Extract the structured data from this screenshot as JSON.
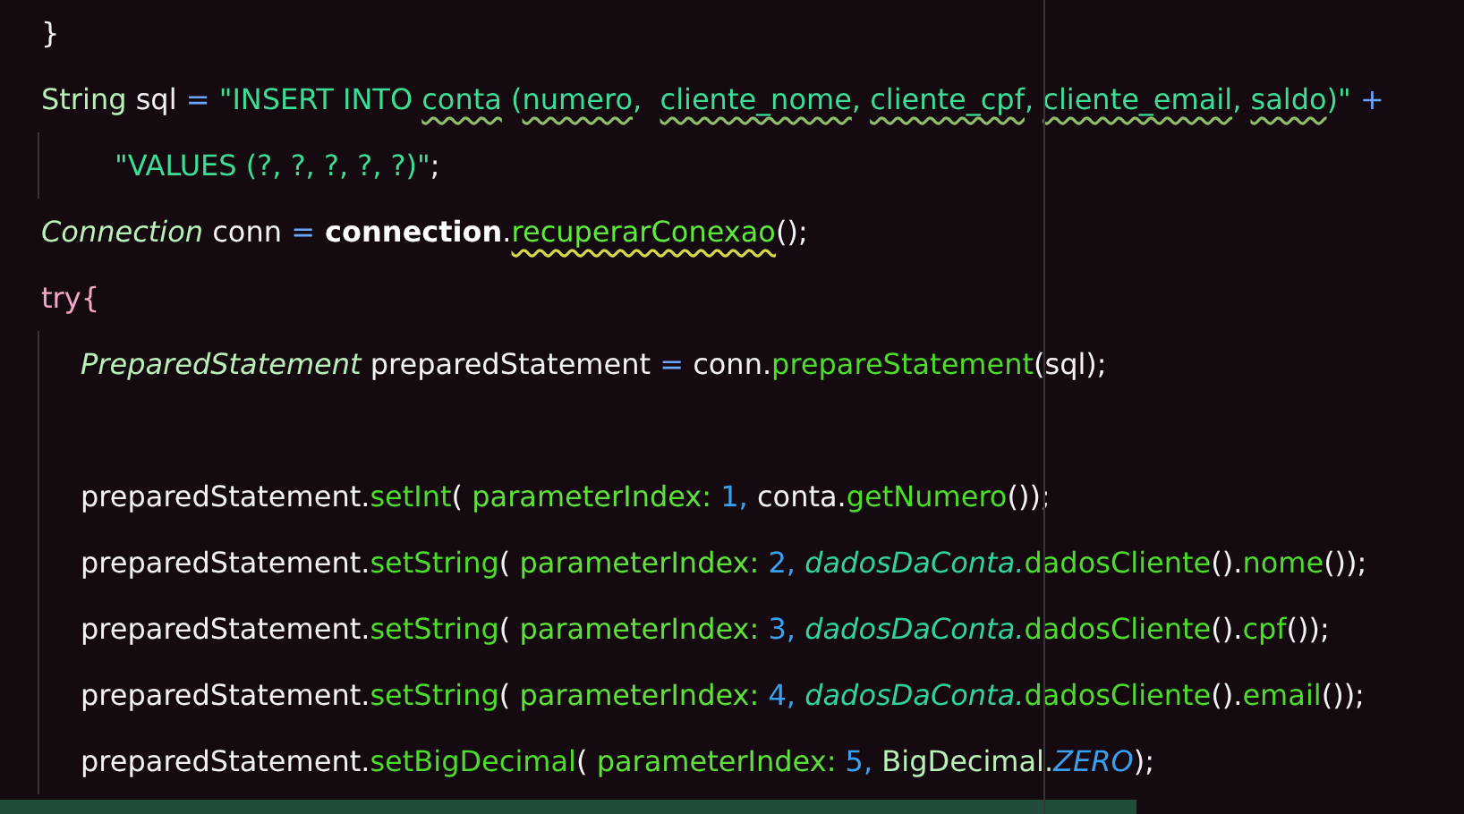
{
  "editor": {
    "lines": [
      {
        "kind": "code",
        "tokens": [
          {
            "kind": "plain",
            "text": "}"
          }
        ]
      },
      {
        "kind": "code",
        "tokens": [
          {
            "kind": "type",
            "text": "String"
          },
          {
            "kind": "plain",
            "text": " sql "
          },
          {
            "kind": "operator",
            "text": "="
          },
          {
            "kind": "string",
            "text": " \"INSERT INTO "
          },
          {
            "kind": "flagged-string",
            "text": "conta"
          },
          {
            "kind": "string",
            "text": " ("
          },
          {
            "kind": "flagged-string",
            "text": "numero"
          },
          {
            "kind": "string",
            "text": ",  "
          },
          {
            "kind": "flagged-string",
            "text": "cliente_nome"
          },
          {
            "kind": "string",
            "text": ", "
          },
          {
            "kind": "flagged-string",
            "text": "cliente_cpf"
          },
          {
            "kind": "string",
            "text": ", "
          },
          {
            "kind": "flagged-string",
            "text": "cliente_email"
          },
          {
            "kind": "string",
            "text": ", "
          },
          {
            "kind": "flagged-string",
            "text": "saldo"
          },
          {
            "kind": "string",
            "text": ")\" "
          },
          {
            "kind": "operator",
            "text": "+"
          }
        ],
        "children": [
          {
            "kind": "continuation",
            "tokens": [
              {
                "kind": "string",
                "text": "\"VALUES (?, ?, ?, ?, ?)\""
              },
              {
                "kind": "plain",
                "text": ";"
              }
            ]
          }
        ]
      },
      {
        "kind": "code",
        "tokens": [
          {
            "kind": "italic-type",
            "text": "Connection"
          },
          {
            "kind": "plain",
            "text": " conn "
          },
          {
            "kind": "operator",
            "text": "="
          },
          {
            "kind": "bold",
            "text": " connection"
          },
          {
            "kind": "plain",
            "text": "."
          },
          {
            "kind": "flagged-method",
            "text": "recuperarConexao"
          },
          {
            "kind": "plain",
            "text": "();"
          }
        ]
      },
      {
        "kind": "code",
        "tokens": [
          {
            "kind": "keyword",
            "text": "try{"
          }
        ],
        "children": [
          {
            "kind": "code",
            "tokens": [
              {
                "kind": "italic-type",
                "text": "PreparedStatement"
              },
              {
                "kind": "plain",
                "text": " preparedStatement "
              },
              {
                "kind": "operator",
                "text": "="
              },
              {
                "kind": "plain",
                "text": " conn."
              },
              {
                "kind": "method",
                "text": "prepareStatement"
              },
              {
                "kind": "plain",
                "text": "(sql);"
              }
            ]
          },
          {
            "kind": "blank"
          },
          {
            "kind": "code",
            "tokens": [
              {
                "kind": "plain",
                "text": "preparedStatement."
              },
              {
                "kind": "method",
                "text": "setInt"
              },
              {
                "kind": "plain",
                "text": "( "
              },
              {
                "kind": "hint",
                "text": "parameterIndex:"
              },
              {
                "kind": "number",
                "text": " 1,"
              },
              {
                "kind": "plain",
                "text": " conta."
              },
              {
                "kind": "method",
                "text": "getNumero"
              },
              {
                "kind": "plain",
                "text": "());"
              }
            ]
          },
          {
            "kind": "code",
            "tokens": [
              {
                "kind": "plain",
                "text": "preparedStatement."
              },
              {
                "kind": "method",
                "text": "setString"
              },
              {
                "kind": "plain",
                "text": "( "
              },
              {
                "kind": "hint",
                "text": "parameterIndex:"
              },
              {
                "kind": "number",
                "text": " 2,"
              },
              {
                "kind": "italic-field",
                "text": " dadosDaConta."
              },
              {
                "kind": "method",
                "text": "dadosCliente"
              },
              {
                "kind": "plain",
                "text": "()."
              },
              {
                "kind": "method",
                "text": "nome"
              },
              {
                "kind": "plain",
                "text": "());"
              }
            ]
          },
          {
            "kind": "code",
            "tokens": [
              {
                "kind": "plain",
                "text": "preparedStatement."
              },
              {
                "kind": "method",
                "text": "setString"
              },
              {
                "kind": "plain",
                "text": "( "
              },
              {
                "kind": "hint",
                "text": "parameterIndex:"
              },
              {
                "kind": "number",
                "text": " 3,"
              },
              {
                "kind": "italic-field",
                "text": " dadosDaConta."
              },
              {
                "kind": "method",
                "text": "dadosCliente"
              },
              {
                "kind": "plain",
                "text": "()."
              },
              {
                "kind": "method",
                "text": "cpf"
              },
              {
                "kind": "plain",
                "text": "());"
              }
            ]
          },
          {
            "kind": "code",
            "tokens": [
              {
                "kind": "plain",
                "text": "preparedStatement."
              },
              {
                "kind": "method",
                "text": "setString"
              },
              {
                "kind": "plain",
                "text": "( "
              },
              {
                "kind": "hint",
                "text": "parameterIndex:"
              },
              {
                "kind": "number",
                "text": " 4,"
              },
              {
                "kind": "italic-field",
                "text": " dadosDaConta."
              },
              {
                "kind": "method",
                "text": "dadosCliente"
              },
              {
                "kind": "plain",
                "text": "()."
              },
              {
                "kind": "method",
                "text": "email"
              },
              {
                "kind": "plain",
                "text": "());"
              }
            ]
          },
          {
            "kind": "code",
            "tokens": [
              {
                "kind": "plain",
                "text": "preparedStatement."
              },
              {
                "kind": "method",
                "text": "setBigDecimal"
              },
              {
                "kind": "plain",
                "text": "( "
              },
              {
                "kind": "hint",
                "text": "parameterIndex:"
              },
              {
                "kind": "number",
                "text": " 5,"
              },
              {
                "kind": "type",
                "text": " BigDecimal."
              },
              {
                "kind": "italic-constant",
                "text": "ZERO"
              },
              {
                "kind": "plain",
                "text": ");"
              }
            ]
          }
        ]
      }
    ]
  }
}
